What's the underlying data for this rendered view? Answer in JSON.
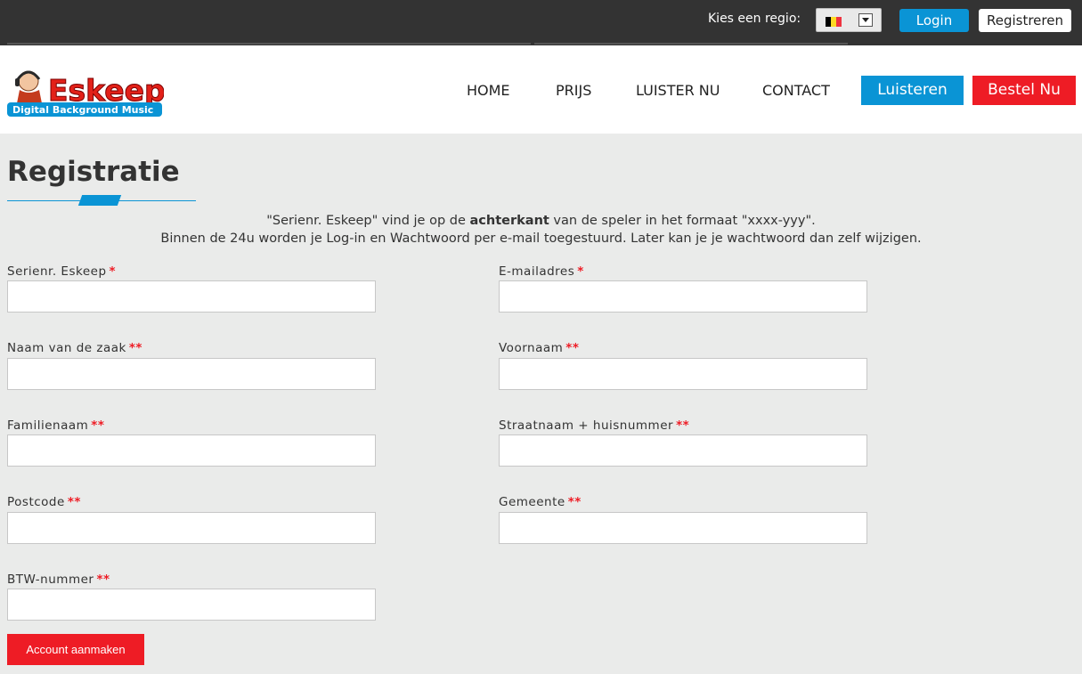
{
  "topbar": {
    "region_label": "Kies een regio:",
    "region_flag": {
      "icon": "belgium-flag-icon",
      "colors": [
        "#000000",
        "#fdda24",
        "#ef3340"
      ]
    },
    "login_label": "Login",
    "register_label": "Registreren"
  },
  "header": {
    "logo": {
      "brand": "Eskeep",
      "tagline": "Digital Background Music"
    },
    "nav": [
      {
        "label": "HOME"
      },
      {
        "label": "PRIJS"
      },
      {
        "label": "LUISTER NU"
      },
      {
        "label": "CONTACT"
      }
    ],
    "listen_label": "Luisteren",
    "order_label": "Bestel Nu"
  },
  "main": {
    "title": "Registratie",
    "intro_line1_pre": "\"Serienr. Eskeep\" vind je op de ",
    "intro_line1_bold": "achterkant",
    "intro_line1_post": " van de speler in het formaat \"xxxx-yyy\".",
    "intro_line2": "Binnen de 24u worden je Log-in en Wachtwoord per e-mail toegestuurd. Later kan je je wachtwoord dan zelf wijzigen.",
    "fields": [
      {
        "label": "Serienr. Eskeep",
        "req": "*",
        "value": ""
      },
      {
        "label": "E-mailadres",
        "req": "*",
        "value": ""
      },
      {
        "label": "Naam van de zaak",
        "req": "**",
        "value": ""
      },
      {
        "label": "Voornaam",
        "req": "**",
        "value": ""
      },
      {
        "label": "Familienaam",
        "req": "**",
        "value": ""
      },
      {
        "label": "Straatnaam + huisnummer",
        "req": "**",
        "value": ""
      },
      {
        "label": "Postcode",
        "req": "**",
        "value": ""
      },
      {
        "label": "Gemeente",
        "req": "**",
        "value": ""
      },
      {
        "label": "BTW-nummer",
        "req": "**",
        "value": ""
      }
    ],
    "submit_label": "Account aanmaken"
  },
  "colors": {
    "topbar": "#333333",
    "accent_blue": "#0a94d5",
    "accent_red": "#ee1c25",
    "page_bg": "#eaebea"
  }
}
